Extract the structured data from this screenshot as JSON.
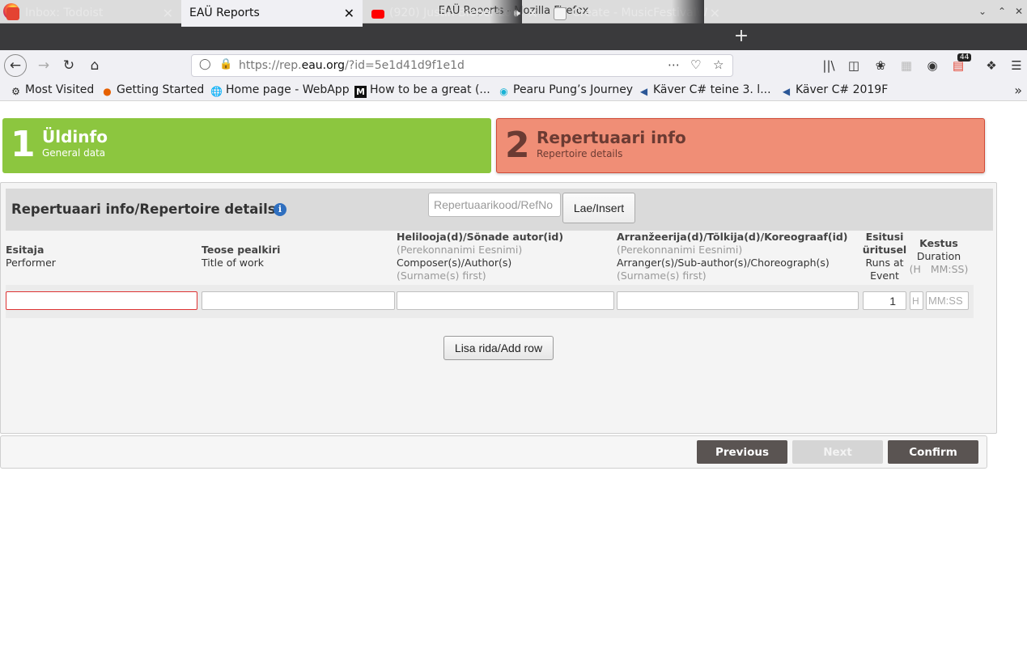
{
  "window": {
    "title": "EAÜ Reports - Mozilla Firefox"
  },
  "tabs": [
    {
      "label": "Inbox: Todoist",
      "icon": "todoist-icon",
      "active": false
    },
    {
      "label": "EAÜ Reports",
      "icon": "",
      "active": true
    },
    {
      "label": "(920) Justin Bieber-Lo",
      "icon": "youtube-icon",
      "active": false
    },
    {
      "label": "Create - MusicFestivalW",
      "icon": "document-icon",
      "active": false
    }
  ],
  "nav": {
    "url_prefix": "https://rep.",
    "url_domain": "eau.org",
    "url_suffix": "/?id=5e1d41d9f1e1d",
    "extensions_badge": "44"
  },
  "bookmarks": [
    {
      "label": "Most Visited",
      "icon": "gear-icon"
    },
    {
      "label": "Getting Started",
      "icon": "firefox-icon"
    },
    {
      "label": "Home page - WebApp",
      "icon": "globe-icon"
    },
    {
      "label": "How to be a great (...",
      "icon": "medium-icon"
    },
    {
      "label": "Pearu Pung’s Journey",
      "icon": "journey-icon"
    },
    {
      "label": "Käver C# teine 3. l...",
      "icon": "play-circle-icon"
    },
    {
      "label": "Käver C# 2019F",
      "icon": "play-circle-icon"
    }
  ],
  "steps": [
    {
      "number": "1",
      "title": "Üldinfo",
      "subtitle": "General data"
    },
    {
      "number": "2",
      "title": "Repertuaari info",
      "subtitle": "Repertoire details"
    }
  ],
  "panel": {
    "title": "Repertuaari info/Repertoire details",
    "ref_placeholder": "Repertuaarikood/RefNo",
    "insert_label": "Lae/Insert",
    "columns": {
      "performer": {
        "et": "Esitaja",
        "en": "Performer"
      },
      "title": {
        "et": "Teose pealkiri",
        "en": "Title of work"
      },
      "composer": {
        "et": "Helilooja(d)/Sõnade autor(id)",
        "hint": "(Perekonnanimi Eesnimi)",
        "en": "Composer(s)/Author(s)",
        "hint_en": "(Surname(s) first)"
      },
      "arranger": {
        "et": "Arranžeerija(d)/Tõlkija(d)/Koreograaf(id)",
        "hint": "(Perekonnanimi Eesnimi)",
        "en": "Arranger(s)/Sub-author(s)/Choreograph(s)",
        "hint_en": "(Surname(s) first)"
      },
      "runs": {
        "et1": "Esitusi",
        "et2": "üritusel",
        "en1": "Runs at",
        "en2": "Event"
      },
      "duration": {
        "et": "Kestus",
        "en": "Duration",
        "hint": "(H   MM:SS)"
      }
    },
    "row": {
      "performer": "",
      "title": "",
      "composer": "",
      "arranger": "",
      "runs": "1",
      "hours_placeholder": "H",
      "mmss_placeholder": "MM:SS"
    },
    "add_row_label": "Lisa rida/Add row"
  },
  "footer": {
    "previous": "Previous",
    "next": "Next",
    "confirm": "Confirm"
  },
  "colors": {
    "step1": "#8cc63f",
    "step2": "#f08e76",
    "button_dark": "#5a5452"
  }
}
